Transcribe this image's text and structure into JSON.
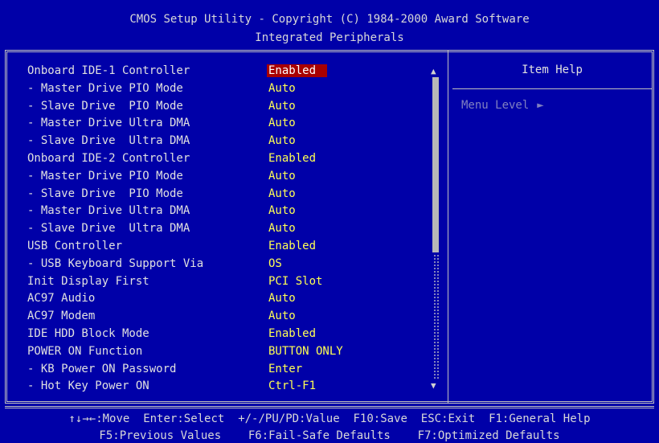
{
  "header": {
    "line1": "CMOS Setup Utility - Copyright (C) 1984-2000 Award Software",
    "line2": "Integrated Peripherals"
  },
  "settings": [
    {
      "label": "Onboard IDE-1 Controller",
      "value": "Enabled",
      "selected": true
    },
    {
      "label": "- Master Drive PIO Mode",
      "value": "Auto"
    },
    {
      "label": "- Slave Drive  PIO Mode",
      "value": "Auto"
    },
    {
      "label": "- Master Drive Ultra DMA",
      "value": "Auto"
    },
    {
      "label": "- Slave Drive  Ultra DMA",
      "value": "Auto"
    },
    {
      "label": "Onboard IDE-2 Controller",
      "value": "Enabled"
    },
    {
      "label": "- Master Drive PIO Mode",
      "value": "Auto"
    },
    {
      "label": "- Slave Drive  PIO Mode",
      "value": "Auto"
    },
    {
      "label": "- Master Drive Ultra DMA",
      "value": "Auto"
    },
    {
      "label": "- Slave Drive  Ultra DMA",
      "value": "Auto"
    },
    {
      "label": "USB Controller",
      "value": "Enabled"
    },
    {
      "label": "- USB Keyboard Support Via",
      "value": "OS"
    },
    {
      "label": "Init Display First",
      "value": "PCI Slot"
    },
    {
      "label": "AC97 Audio",
      "value": "Auto"
    },
    {
      "label": "AC97 Modem",
      "value": "Auto"
    },
    {
      "label": "IDE HDD Block Mode",
      "value": "Enabled"
    },
    {
      "label": "POWER ON Function",
      "value": "BUTTON ONLY"
    },
    {
      "label": "- KB Power ON Password",
      "value": "Enter"
    },
    {
      "label": "- Hot Key Power ON",
      "value": "Ctrl-F1"
    }
  ],
  "help": {
    "title": "Item Help",
    "menu_level": "Menu Level",
    "menu_level_icon": "right-triangle-icon"
  },
  "scrollbar": {
    "up_icon": "up-arrow-icon",
    "down_icon": "down-arrow-icon",
    "position": 0.0
  },
  "footer": {
    "line1": "↑↓→←:Move  Enter:Select  +/-/PU/PD:Value  F10:Save  ESC:Exit  F1:General Help",
    "line2": "F5:Previous Values    F6:Fail-Safe Defaults    F7:Optimized Defaults"
  },
  "colors": {
    "background": "#0000a8",
    "label": "#e0e0e0",
    "value": "#ffff54",
    "selected_bg": "#a80000",
    "menu_level": "#8080c0"
  }
}
